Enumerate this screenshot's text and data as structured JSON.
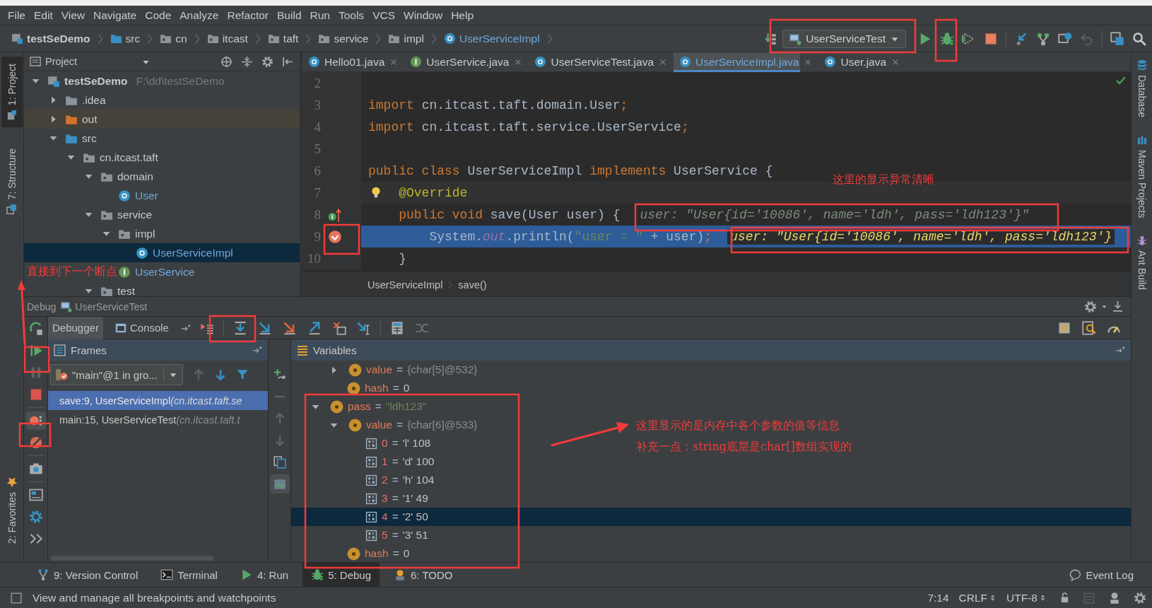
{
  "menu": [
    "File",
    "Edit",
    "View",
    "Navigate",
    "Code",
    "Analyze",
    "Refactor",
    "Build",
    "Run",
    "Tools",
    "VCS",
    "Window",
    "Help"
  ],
  "breadcrumb": [
    {
      "label": "testSeDemo",
      "kind": "module"
    },
    {
      "label": "src",
      "kind": "source"
    },
    {
      "label": "cn",
      "kind": "package"
    },
    {
      "label": "itcast",
      "kind": "package"
    },
    {
      "label": "taft",
      "kind": "package"
    },
    {
      "label": "service",
      "kind": "package"
    },
    {
      "label": "impl",
      "kind": "package"
    },
    {
      "label": "UserServiceImpl",
      "kind": "class"
    }
  ],
  "run_config": {
    "label": "UserServiceTest"
  },
  "left_strip": [
    {
      "label": "1: Project",
      "selected": true
    },
    {
      "label": "7: Structure",
      "selected": false
    }
  ],
  "favorites": {
    "label": "2: Favorites"
  },
  "project": {
    "title": "Project",
    "tree": [
      {
        "label": "testSeDemo",
        "path": "F:\\dd\\testSeDemo",
        "kind": "module",
        "expanded": true,
        "selected": false,
        "children": [
          {
            "label": ".idea",
            "kind": "folder",
            "expanded": false,
            "selected": false
          },
          {
            "label": "out",
            "kind": "excluded",
            "expanded": false,
            "selected": false
          },
          {
            "label": "src",
            "kind": "source",
            "expanded": true,
            "selected": false,
            "children": [
              {
                "label": "cn.itcast.taft",
                "kind": "package",
                "expanded": true,
                "selected": false,
                "children": [
                  {
                    "label": "domain",
                    "kind": "package",
                    "expanded": true,
                    "selected": false,
                    "children": [
                      {
                        "label": "User",
                        "kind": "class",
                        "selected": false
                      }
                    ]
                  },
                  {
                    "label": "service",
                    "kind": "package",
                    "expanded": true,
                    "selected": false,
                    "children": [
                      {
                        "label": "impl",
                        "kind": "package",
                        "expanded": true,
                        "selected": false,
                        "children": [
                          {
                            "label": "UserServiceImpl",
                            "kind": "class",
                            "selected": true
                          }
                        ]
                      },
                      {
                        "label": "UserService",
                        "kind": "interface",
                        "selected": false
                      }
                    ]
                  },
                  {
                    "label": "test",
                    "kind": "package",
                    "expanded": true,
                    "selected": false
                  }
                ]
              }
            ]
          }
        ]
      }
    ]
  },
  "editor_tabs": [
    {
      "label": "Hello01.java",
      "kind": "class",
      "selected": false
    },
    {
      "label": "UserService.java",
      "kind": "interface",
      "selected": false
    },
    {
      "label": "UserServiceTest.java",
      "kind": "class",
      "selected": false
    },
    {
      "label": "UserServiceImpl.java",
      "kind": "class",
      "selected": true
    },
    {
      "label": "User.java",
      "kind": "class",
      "selected": false
    }
  ],
  "code_lines": [
    {
      "number": "2"
    },
    {
      "number": "3",
      "segments": [
        {
          "text": "import ",
          "kind": "keyword"
        },
        {
          "text": "cn.itcast.taft.domain.User",
          "kind": "plain"
        },
        {
          "text": ";",
          "kind": "keyword"
        }
      ]
    },
    {
      "number": "4",
      "segments": [
        {
          "text": "import ",
          "kind": "keyword"
        },
        {
          "text": "cn.itcast.taft.service.UserService",
          "kind": "plain"
        },
        {
          "text": ";",
          "kind": "keyword"
        }
      ]
    },
    {
      "number": "5"
    },
    {
      "number": "6",
      "segments": [
        {
          "text": "public class ",
          "kind": "keyword"
        },
        {
          "text": "UserServiceImpl ",
          "kind": "plain"
        },
        {
          "text": "implements ",
          "kind": "keyword"
        },
        {
          "text": "UserService {",
          "kind": "plain"
        }
      ]
    },
    {
      "number": "7",
      "intention": true,
      "caret_line": true,
      "segments": [
        {
          "text": "@Override",
          "kind": "annotation"
        }
      ]
    },
    {
      "number": "8",
      "gutter_icon": {
        "kind": "implements"
      },
      "segments": [
        {
          "text": "public void ",
          "kind": "keyword"
        },
        {
          "text": "save(User user) {",
          "kind": "plain"
        }
      ],
      "hint": "user: \"User{id='10086', name='ldh', pass='ldh123'}\""
    },
    {
      "number": "9",
      "gutter_icon": {
        "kind": "breakpoint"
      },
      "current": true,
      "segments": [
        {
          "text": "System.",
          "kind": "plain"
        },
        {
          "text": "out",
          "kind": "static"
        },
        {
          "text": ".println(",
          "kind": "plain"
        },
        {
          "text": "\"user = \"",
          "kind": "string"
        },
        {
          "text": " + user)",
          "kind": "plain"
        },
        {
          "text": ";",
          "kind": "keyword"
        }
      ],
      "hint": "user: \"User{id='10086', name='ldh', pass='ldh123'}"
    },
    {
      "number": "10",
      "segments": [
        {
          "text": "}",
          "kind": "plain"
        }
      ]
    }
  ],
  "editor_breadcrumb": [
    "UserServiceImpl",
    "save()"
  ],
  "right_strip": [
    {
      "label": "Database",
      "kind": "database"
    },
    {
      "label": "Maven Projects",
      "kind": "maven"
    },
    {
      "label": "Ant Build",
      "kind": "ant"
    }
  ],
  "debug": {
    "title": "Debug",
    "config": "UserServiceTest",
    "tabs": [
      {
        "label": "Debugger",
        "selected": true
      },
      {
        "label": "Console",
        "selected": false
      }
    ],
    "frames": {
      "title": "Frames",
      "thread": "\"main\"@1 in gro...",
      "items": [
        {
          "method": "save:9, UserServiceImpl",
          "location": "(cn.itcast.taft.se",
          "selected": true
        },
        {
          "method": "main:15, UserServiceTest",
          "location": "(cn.itcast.taft.t",
          "selected": false
        }
      ]
    },
    "variables": {
      "title": "Variables",
      "items": [
        {
          "kind": "offscreen",
          "children": [
            {
              "name": "value",
              "operator": "=",
              "value": {
                "text": "{char[5]@532}",
                "kind": "ref"
              },
              "kind": "field",
              "expanded": false,
              "selected": false
            },
            {
              "name": "hash",
              "operator": "=",
              "value": {
                "text": "0",
                "kind": "plain"
              },
              "kind": "field",
              "selected": false
            }
          ]
        },
        {
          "name": "pass",
          "operator": "=",
          "value": {
            "text": "\"ldh123\"",
            "kind": "string"
          },
          "kind": "field",
          "expanded": true,
          "selected": false,
          "children": [
            {
              "name": "value",
              "operator": "=",
              "value": {
                "text": "{char[6]@533}",
                "kind": "ref"
              },
              "kind": "field",
              "expanded": true,
              "selected": false,
              "children": [
                {
                  "name": "0",
                  "operator": "=",
                  "value": {
                    "text": "'l' 108",
                    "kind": "plain"
                  },
                  "kind": "element",
                  "selected": false
                },
                {
                  "name": "1",
                  "operator": "=",
                  "value": {
                    "text": "'d' 100",
                    "kind": "plain"
                  },
                  "kind": "element",
                  "selected": false
                },
                {
                  "name": "2",
                  "operator": "=",
                  "value": {
                    "text": "'h' 104",
                    "kind": "plain"
                  },
                  "kind": "element",
                  "selected": false
                },
                {
                  "name": "3",
                  "operator": "=",
                  "value": {
                    "text": "'1' 49",
                    "kind": "plain"
                  },
                  "kind": "element",
                  "selected": false
                },
                {
                  "name": "4",
                  "operator": "=",
                  "value": {
                    "text": "'2' 50",
                    "kind": "plain"
                  },
                  "kind": "element",
                  "selected": true
                },
                {
                  "name": "5",
                  "operator": "=",
                  "value": {
                    "text": "'3' 51",
                    "kind": "plain"
                  },
                  "kind": "element",
                  "selected": false
                }
              ]
            },
            {
              "name": "hash",
              "operator": "=",
              "value": {
                "text": "0",
                "kind": "plain"
              },
              "kind": "field",
              "selected": false
            }
          ]
        }
      ]
    }
  },
  "tool_tabs": [
    {
      "label": "9: Version Control",
      "kind": "vcs",
      "selected": false
    },
    {
      "label": "Terminal",
      "kind": "terminal",
      "selected": false
    },
    {
      "label": "4: Run",
      "kind": "run",
      "selected": false
    },
    {
      "label": "5: Debug",
      "kind": "debug",
      "selected": true
    },
    {
      "label": "6: TODO",
      "kind": "todo",
      "selected": false
    }
  ],
  "event_log": "Event Log",
  "status_bar": {
    "message": "View and manage all breakpoints and watchpoints",
    "position": "7:14",
    "line_separator": "CRLF",
    "encoding": "UTF-8"
  },
  "annotations": [
    {
      "text": "直接到下一个断点"
    },
    {
      "text": "这里的显示异常清晰"
    },
    {
      "text": "这里显示的是内存中各个参数的值等信息"
    },
    {
      "text": "补充一点：string底层是char[]数组实现的"
    }
  ]
}
